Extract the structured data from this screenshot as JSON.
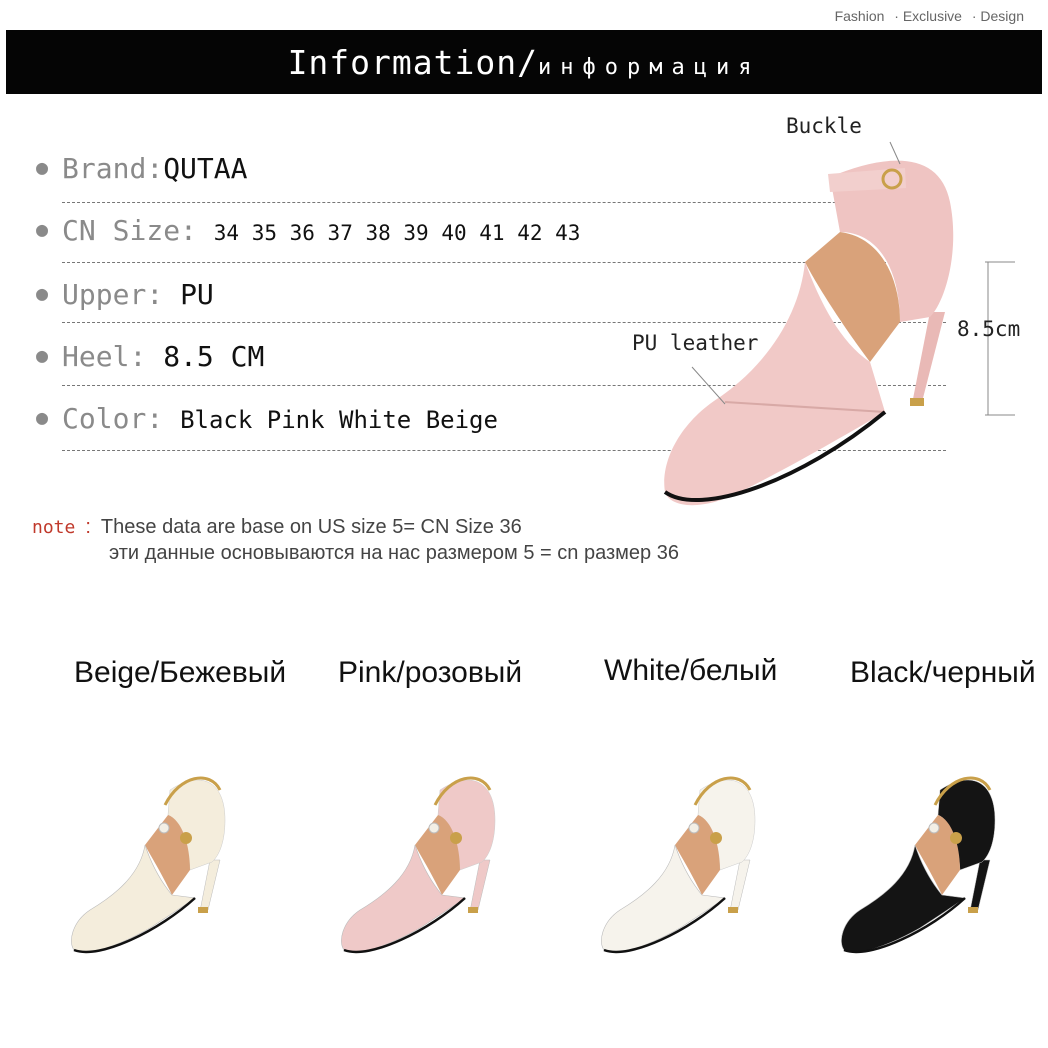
{
  "tagline": [
    "Fashion",
    "· Exclusive",
    "· Design"
  ],
  "banner": {
    "title_en": "Information/",
    "title_ru": "информация"
  },
  "specs": {
    "brand": {
      "label": "Brand:",
      "value": "QUTAA"
    },
    "size": {
      "label": "CN Size:",
      "value": "34 35 36 37 38 39 40 41 42 43"
    },
    "upper": {
      "label": "Upper: ",
      "value": "PU"
    },
    "heel": {
      "label": "Heel: ",
      "value": "8.5 CM"
    },
    "color": {
      "label": "Color:",
      "value": "Black  Pink  White  Beige"
    }
  },
  "annotations": {
    "buckle": "Buckle",
    "leather": "PU leather",
    "height": "8.5cm"
  },
  "note": {
    "label": "note",
    "colon": ":",
    "line1": "These data are base on US size 5= CN Size 36",
    "line2": "эти данные основываются на нас размером 5 = cn размер 36"
  },
  "variants": [
    {
      "label": "Beige/Бежевый",
      "color": "#f4eddc"
    },
    {
      "label": "Pink/розовый",
      "color": "#efc9c8"
    },
    {
      "label": "White/белый",
      "color": "#f6f3ec"
    },
    {
      "label": "Black/черный",
      "color": "#141414"
    }
  ],
  "colors": {
    "banner": "#050505",
    "note_label": "#c0392b",
    "lining": "#d9a27a",
    "gold": "#c9a04a"
  }
}
